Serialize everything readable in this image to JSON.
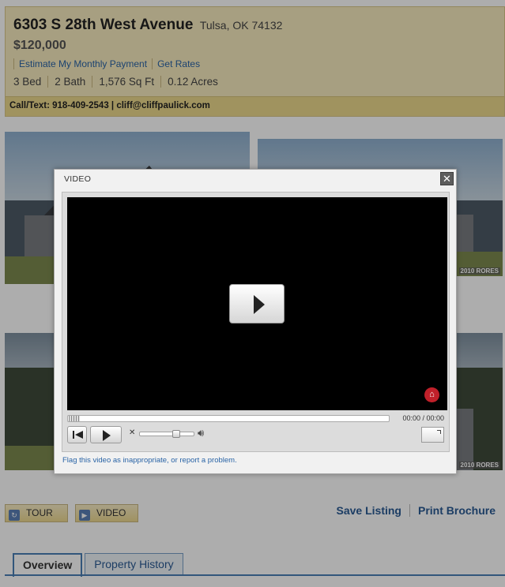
{
  "listing": {
    "street": "6303 S 28th West Avenue",
    "city_state_zip": "Tulsa, OK 74132",
    "price": "$120,000",
    "links": [
      "Estimate My Monthly Payment",
      "Get Rates"
    ],
    "specs": [
      "3 Bed",
      "2 Bath",
      "1,576 Sq Ft",
      "0.12 Acres"
    ],
    "contact": "Call/Text: 918-409-2543 | cliff@cliffpaulick.com"
  },
  "photos": {
    "watermark": "2010 RORES"
  },
  "actions": {
    "tour_label": "TOUR",
    "video_label": "VIDEO",
    "save_label": "Save Listing",
    "print_label": "Print Brochure"
  },
  "tabs": [
    {
      "label": "Overview",
      "active": true
    },
    {
      "label": "Property History",
      "active": false
    }
  ],
  "modal": {
    "title": "VIDEO",
    "close_glyph": "✕",
    "time": "00:00 / 00:00",
    "progress": 0,
    "volume": 0.7,
    "report_text": "Flag this video as inappropriate, or report a problem."
  },
  "icons": {
    "close": "close-icon",
    "play": "play-icon",
    "rewind": "rewind-icon",
    "mute": "mute-icon",
    "speaker": "speaker-icon",
    "fullscreen": "fullscreen-icon",
    "home": "home-icon"
  },
  "colors": {
    "header_bg": "#f7ebbf",
    "link": "#2a64a6",
    "tab_accent": "#4a7fb5",
    "video_bg": "#000000",
    "home_badge": "#c0202a"
  }
}
